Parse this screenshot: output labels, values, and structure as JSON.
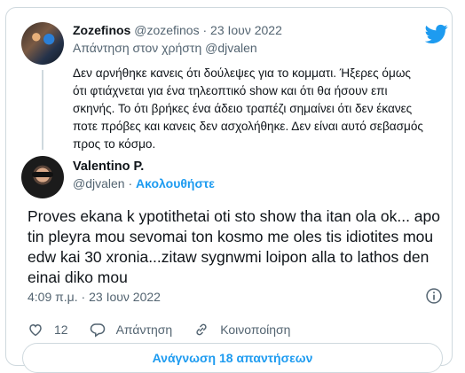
{
  "parent_tweet": {
    "name": "Zozefinos",
    "handle": "@zozefinos",
    "separator": "·",
    "date": "23 Ιουν 2022",
    "reply_prefix": "Απάντηση στον χρήστη ",
    "reply_mention": "@djvalen",
    "text": "Δεν αρνήθηκε κανεις ότι δούλεψες για το κομματι. Ήξερες όμως ότι φτιάχνεται για ένα τηλεοπτικό show και ότι θα ήσουν επι σκηνής. Το ότι βρήκες ένα άδειο τραπέζι σημαίνει ότι δεν έκανες ποτε πρόβες και κανεις δεν ασχολήθηκε. Δεν είναι αυτό σεβασμός προς το κόσμο."
  },
  "main_tweet": {
    "name": "Valentino P.",
    "handle": "@djvalen",
    "separator": "·",
    "follow_label": "Ακολουθήστε",
    "text": "Proves ekana k ypotithetai oti sto show tha itan ola ok...\napo tin pleyra mou sevomai ton kosmo me oles tis idiotites mou edw kai 30 xronia...zitaw sygnwmi loipon alla to lathos den einai diko mou",
    "time": "4:09 π.μ.",
    "date": "23 Ιουν 2022",
    "meta_separator": "·"
  },
  "actions": {
    "like_count": "12",
    "reply_label": "Απάντηση",
    "share_label": "Κοινοποίηση"
  },
  "read_replies_label": "Ανάγνωση 18 απαντήσεων",
  "icons": {
    "logo": "twitter-bird-icon",
    "info": "info-icon",
    "like": "heart-icon",
    "reply": "speech-bubble-icon",
    "share": "link-icon"
  },
  "colors": {
    "accent": "#1d9bf0",
    "text": "#0f1419",
    "secondary": "#536471",
    "border": "#cfd9de"
  }
}
